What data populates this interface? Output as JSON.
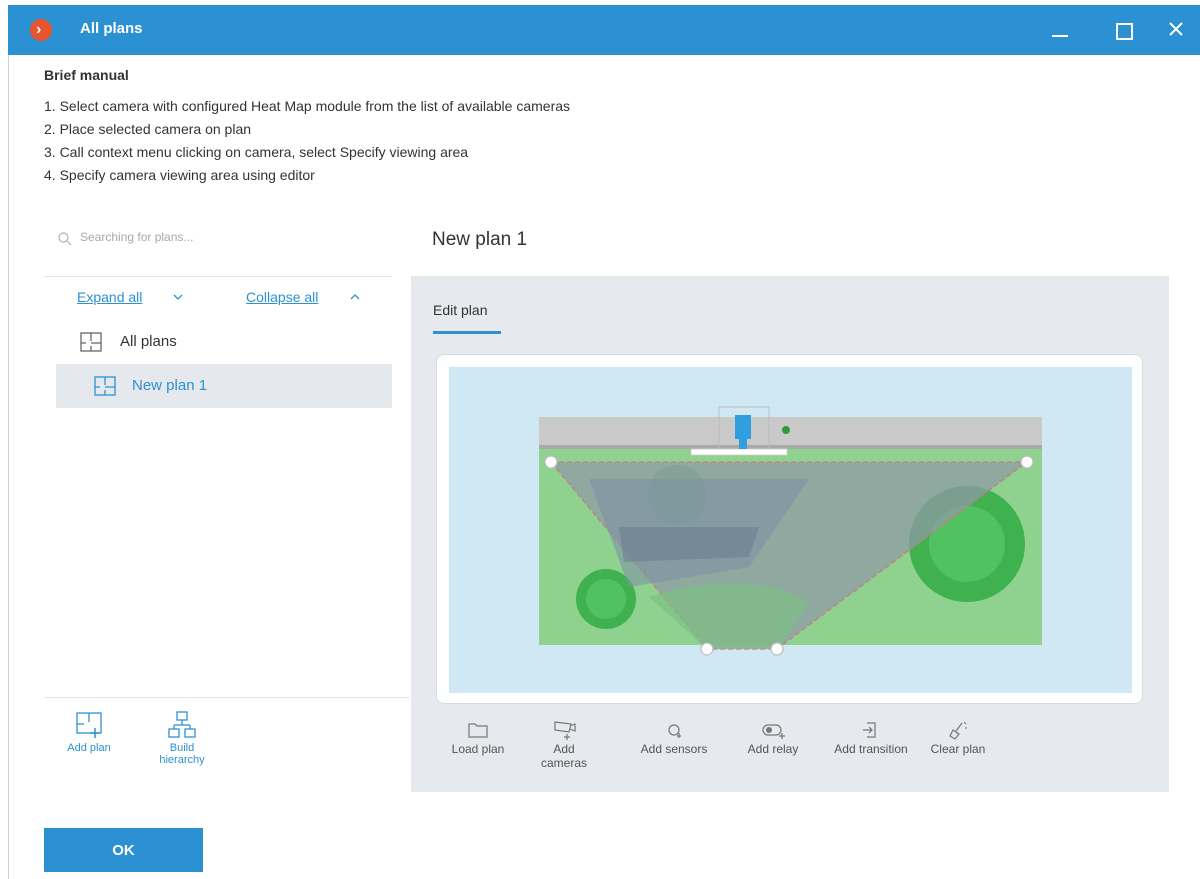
{
  "window": {
    "title": "All plans",
    "logo_glyph": "›",
    "controls": [
      "minimize-icon",
      "maximize-icon",
      "close-icon"
    ]
  },
  "manual": {
    "title": "Brief manual",
    "steps": [
      "1. Select camera with configured Heat Map module from the list of available cameras",
      "2. Place selected camera on plan",
      "3. Call context menu clicking on camera, select Specify viewing area",
      "4. Specify camera viewing area using editor"
    ]
  },
  "sidebar": {
    "search_placeholder": "Searching for plans...",
    "expand_label": "Expand all",
    "collapse_label": "Collapse all",
    "tree": [
      {
        "label": "All plans",
        "icon": "plan-icon"
      },
      {
        "label": "New plan 1",
        "icon": "plan-icon",
        "selected": true
      }
    ],
    "tools": {
      "add_plan": "Add plan",
      "build_hierarchy": "Build hierarchy"
    }
  },
  "main": {
    "plan_title": "New plan 1",
    "tab_label": "Edit plan",
    "toolbar": [
      {
        "label": "Load plan",
        "icon": "folder-icon"
      },
      {
        "label": "Add cameras",
        "icon": "camera-add-icon"
      },
      {
        "label": "Add sensors",
        "icon": "sensor-icon"
      },
      {
        "label": "Add relay",
        "icon": "relay-icon"
      },
      {
        "label": "Add transition",
        "icon": "transition-icon"
      },
      {
        "label": "Clear plan",
        "icon": "clear-icon"
      }
    ]
  },
  "footer": {
    "ok_label": "OK"
  },
  "colors": {
    "accent": "#2c91d2",
    "logo": "#e8542c",
    "panel": "#e6e9ed",
    "canvas": "#cfe8f4",
    "grass": "#8fd290"
  }
}
